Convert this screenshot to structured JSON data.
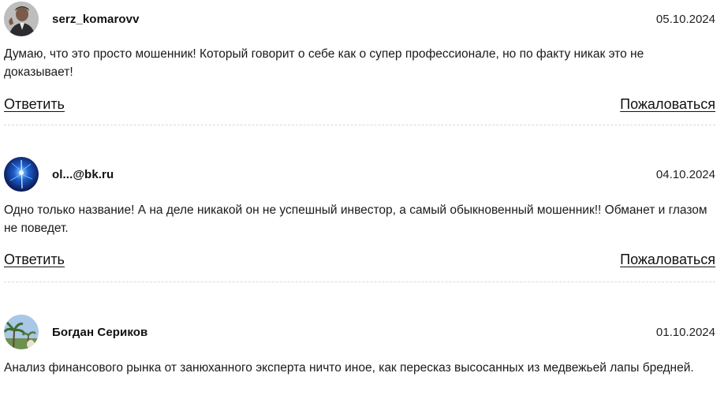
{
  "comments": [
    {
      "author": "serz_komarovv",
      "date": "05.10.2024",
      "text": "Думаю, что это просто мошенник! Который говорит о себе как о супер профессионале, но по факту никак это не доказывает!",
      "reply_label": "Ответить",
      "report_label": "Пожаловаться",
      "avatar_icon": "user-photo-avatar"
    },
    {
      "author": "ol...@bk.ru",
      "date": "04.10.2024",
      "text": "Одно только название! А на деле никакой он не успешный инвестор, а самый обыкновенный мошенник!! Обманет и глазом не поведет.",
      "reply_label": "Ответить",
      "report_label": "Пожаловаться",
      "avatar_icon": "blue-abstract-avatar"
    },
    {
      "author": "Богдан Сериков",
      "date": "01.10.2024",
      "text": "Анализ финансового рынка от занюханного эксперта ничто иное, как пересказ высосанных из медвежьей лапы бредней.",
      "avatar_icon": "palm-landscape-avatar"
    }
  ],
  "colors": {
    "text": "#111111",
    "divider": "#d9d9d9",
    "background": "#ffffff"
  }
}
